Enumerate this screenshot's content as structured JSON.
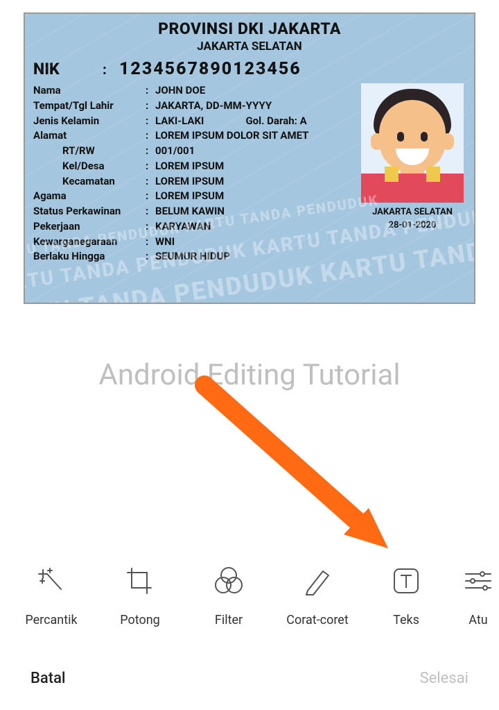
{
  "watermark": "Android Editing Tutorial",
  "card": {
    "header_line1": "PROVINSI DKI JAKARTA",
    "header_line2": "JAKARTA SELATAN",
    "nik_label": "NIK",
    "nik_value": "1234567890123456",
    "fields": {
      "nama": {
        "label": "Nama",
        "value": "JOHN DOE"
      },
      "ttl": {
        "label": "Tempat/Tgl Lahir",
        "value": "JAKARTA, DD-MM-YYYY"
      },
      "jk": {
        "label": "Jenis Kelamin",
        "value": "LAKI-LAKI"
      },
      "gol_darah": {
        "label": "Gol. Darah:",
        "value": "A"
      },
      "alamat": {
        "label": "Alamat",
        "value": "LOREM IPSUM DOLOR SIT AMET"
      },
      "rtrw": {
        "label": "RT/RW",
        "value": "001/001"
      },
      "keldesa": {
        "label": "Kel/Desa",
        "value": "LOREM IPSUM"
      },
      "kecamatan": {
        "label": "Kecamatan",
        "value": "LOREM IPSUM"
      },
      "agama": {
        "label": "Agama",
        "value": "LOREM IPSUM"
      },
      "status": {
        "label": "Status Perkawinan",
        "value": "BELUM KAWIN"
      },
      "pekerjaan": {
        "label": "Pekerjaan",
        "value": "KARYAWAN"
      },
      "kewarganegaraan": {
        "label": "Kewarganegaraan",
        "value": "WNI"
      },
      "berlaku": {
        "label": "Berlaku Hingga",
        "value": "SEUMUR HIDUP"
      }
    },
    "photo_caption_place": "JAKARTA SELATAN",
    "photo_caption_date": "28-01-2020",
    "bg_watermark": "KARTU TANDA PENDUDUK KARTU TANDA PENDUDUK"
  },
  "toolbar": {
    "items": [
      {
        "label": "Percantik",
        "icon": "sparkle-wand-icon"
      },
      {
        "label": "Potong",
        "icon": "crop-icon"
      },
      {
        "label": "Filter",
        "icon": "filter-venn-icon"
      },
      {
        "label": "Corat-coret",
        "icon": "pencil-icon"
      },
      {
        "label": "Teks",
        "icon": "text-box-icon"
      },
      {
        "label": "Atu",
        "icon": "sliders-icon"
      }
    ]
  },
  "bottom": {
    "cancel": "Batal",
    "done": "Selesai"
  },
  "colors": {
    "arrow": "#ff6a13",
    "card_bg": "#a5c6df"
  }
}
